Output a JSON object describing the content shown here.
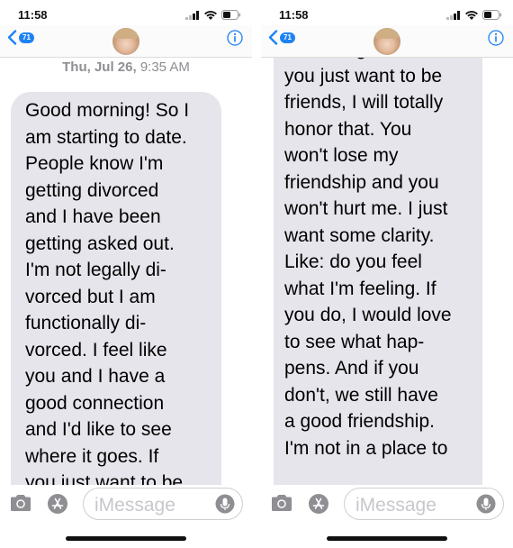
{
  "left": {
    "status_time": "11:58",
    "back_badge": "71",
    "timestamp_date": "Thu, Jul 26,",
    "timestamp_time": "9:35 AM",
    "bubble_text": "Good morning! So I\nam starting to date.\nPeople know I'm\ngetting divorced\nand I have been\ngetting asked out.\nI'm not legally di-\nvorced but I am\nfunctionally di-\nvorced.  I feel like\nyou and I have a\ngood connection\nand I'd like to see\nwhere it goes. If\nyou just want to be",
    "input_placeholder": "iMessage"
  },
  "right": {
    "status_time": "11:58",
    "back_badge": "71",
    "bubble_text": "where it goes. If\nyou just want to be\nfriends, I will totally\nhonor that. You\nwon't lose my\nfriendship and you\nwon't hurt me. I just\nwant some clarity.\nLike: do you feel\nwhat I'm feeling. If\nyou do, I would love\nto see what hap-\npens. And if you\ndon't, we still have\na good friendship.\nI'm not in a place to",
    "input_placeholder": "iMessage"
  },
  "colors": {
    "accent": "#1e82f5",
    "bubble_received": "#e6e5eb",
    "timestamp_gray": "#8e8e93",
    "placeholder_gray": "#c7c7cc"
  },
  "icons": [
    "back-chevron-icon",
    "info-icon",
    "camera-icon",
    "app-store-icon",
    "microphone-icon",
    "signal-icon",
    "wifi-icon",
    "battery-icon"
  ]
}
